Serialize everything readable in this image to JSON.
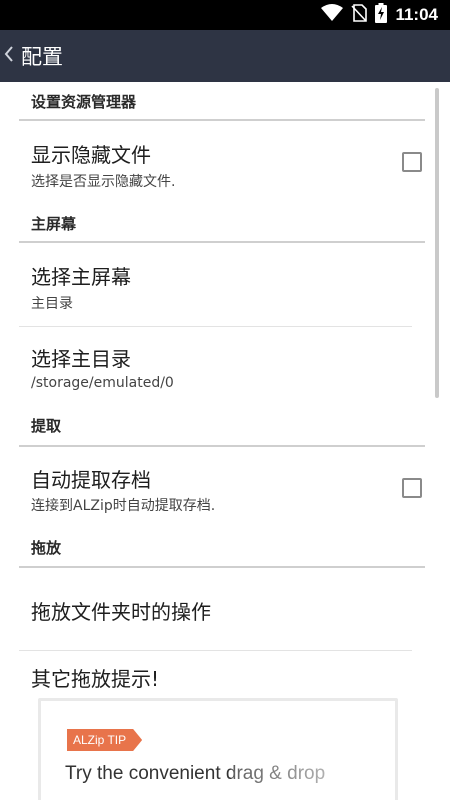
{
  "status_bar": {
    "time": "11:04",
    "icons": [
      "wifi-icon",
      "no-sim-icon",
      "battery-charging-icon"
    ]
  },
  "app_bar": {
    "back_icon": "chevron-left-icon",
    "title": "配置"
  },
  "sections": {
    "file_manager": {
      "header": "设置资源管理器",
      "show_hidden": {
        "title": "显示隐藏文件",
        "summary": "选择是否显示隐藏文件.",
        "checked": false
      }
    },
    "home": {
      "header": "主屏幕",
      "choose_home_screen": {
        "title": "选择主屏幕",
        "summary": "主目录"
      },
      "choose_home_dir": {
        "title": "选择主目录",
        "summary": "/storage/emulated/0"
      }
    },
    "extract": {
      "header": "提取",
      "auto_extract": {
        "title": "自动提取存档",
        "summary": "连接到ALZip时自动提取存档.",
        "checked": false
      }
    },
    "drag_drop": {
      "header": "拖放",
      "folder_drop_action": {
        "title": "拖放文件夹时的操作"
      },
      "other_tips": {
        "title": "其它拖放提示!",
        "card": {
          "badge": "ALZip TIP",
          "text": "Try the convenient drag & drop"
        }
      }
    }
  },
  "colors": {
    "status_bar": "#000000",
    "app_bar": "#2e3444",
    "tip_badge": "#e8744b"
  }
}
